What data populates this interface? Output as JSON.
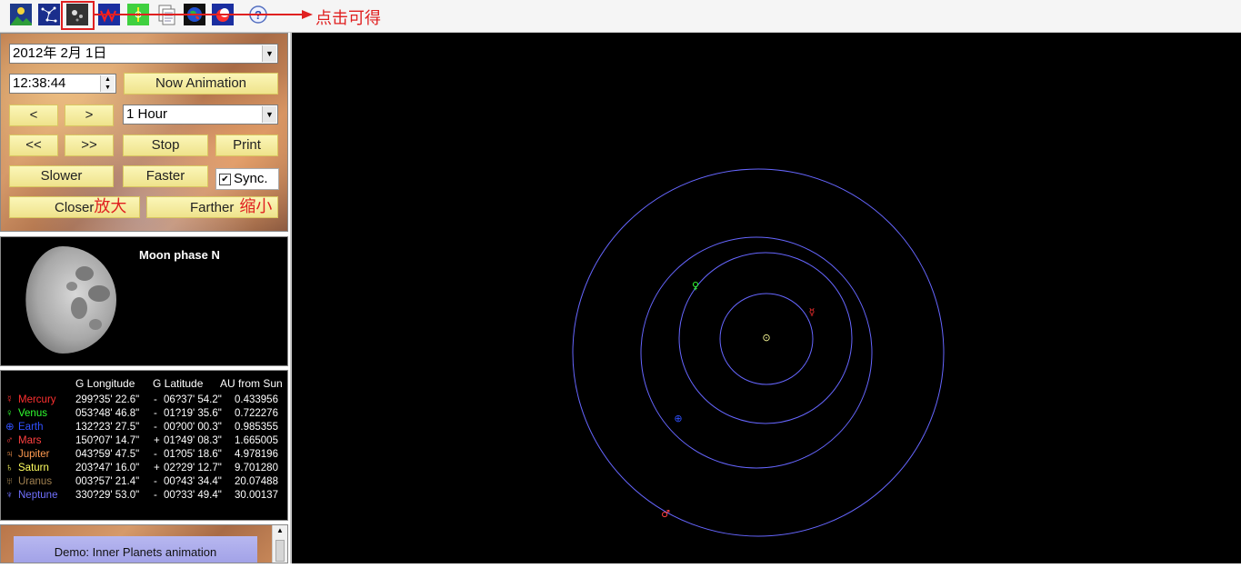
{
  "toolbar": {
    "icons": [
      "landscape-icon",
      "constellation-icon",
      "solar-system-icon",
      "red-chart-icon",
      "green-chart-icon",
      "document-icon",
      "globe-icon",
      "moon-icon",
      "help-icon"
    ],
    "annotation": "点击可得"
  },
  "controls": {
    "date_value": "2012年  2月  1日",
    "time_value": "12:38:44",
    "now_animation_label": "Now Animation",
    "step_back_label": "<",
    "step_forward_label": ">",
    "interval_value": "1 Hour",
    "fast_back_label": "<<",
    "fast_forward_label": ">>",
    "stop_label": "Stop",
    "print_label": "Print",
    "slower_label": "Slower",
    "faster_label": "Faster",
    "sync_label": "Sync.",
    "sync_checked": true,
    "closer_label": "Closer",
    "closer_annotation": "放大",
    "farther_label": "Farther",
    "farther_annotation": "缩小"
  },
  "moon": {
    "title": "Moon phase  N"
  },
  "planet_table": {
    "headers": [
      "G Longitude",
      "G Latitude",
      "AU from Sun"
    ],
    "rows": [
      {
        "symbol": "☿",
        "name": "Mercury",
        "color": "#ff3030",
        "lon": "299?35' 22.6\"",
        "sign": "-",
        "lat": "06?37' 54.2\"",
        "au": "0.433956"
      },
      {
        "symbol": "♀",
        "name": "Venus",
        "color": "#30ff30",
        "lon": "053?48' 46.8\"",
        "sign": "-",
        "lat": "01?19' 35.6\"",
        "au": "0.722276"
      },
      {
        "symbol": "⊕",
        "name": "Earth",
        "color": "#3050ff",
        "lon": "132?23' 27.5\"",
        "sign": "-",
        "lat": "00?00' 00.3\"",
        "au": "0.985355"
      },
      {
        "symbol": "♂",
        "name": "Mars",
        "color": "#ff4040",
        "lon": "150?07' 14.7\"",
        "sign": "+",
        "lat": "01?49' 08.3\"",
        "au": "1.665005"
      },
      {
        "symbol": "♃",
        "name": "Jupiter",
        "color": "#ff9a50",
        "lon": "043?59' 47.5\"",
        "sign": "-",
        "lat": "01?05' 18.6\"",
        "au": "4.978196"
      },
      {
        "symbol": "♄",
        "name": "Saturn",
        "color": "#ffff60",
        "lon": "203?47' 16.0\"",
        "sign": "+",
        "lat": "02?29' 12.7\"",
        "au": "9.701280"
      },
      {
        "symbol": "♅",
        "name": "Uranus",
        "color": "#a08050",
        "lon": "003?57' 21.4\"",
        "sign": "-",
        "lat": "00?43' 34.4\"",
        "au": "20.07488"
      },
      {
        "symbol": "♆",
        "name": "Neptune",
        "color": "#7070ff",
        "lon": "330?29' 53.0\"",
        "sign": "-",
        "lat": "00?33' 49.4\"",
        "au": "30.00137"
      }
    ]
  },
  "demo": {
    "label": "Demo: Inner Planets animation"
  },
  "sky": {
    "orbit_color": "#6666ff",
    "sun_symbol": "⊙",
    "bodies": [
      {
        "name": "sun",
        "symbol": "⊙",
        "color": "#ffff99"
      },
      {
        "name": "mercury",
        "symbol": "☿",
        "color": "#ff3030"
      },
      {
        "name": "venus",
        "symbol": "♀",
        "color": "#30ff30"
      },
      {
        "name": "earth",
        "symbol": "⊕",
        "color": "#3050ff"
      },
      {
        "name": "mars",
        "symbol": "♂",
        "color": "#ff4040"
      }
    ]
  }
}
